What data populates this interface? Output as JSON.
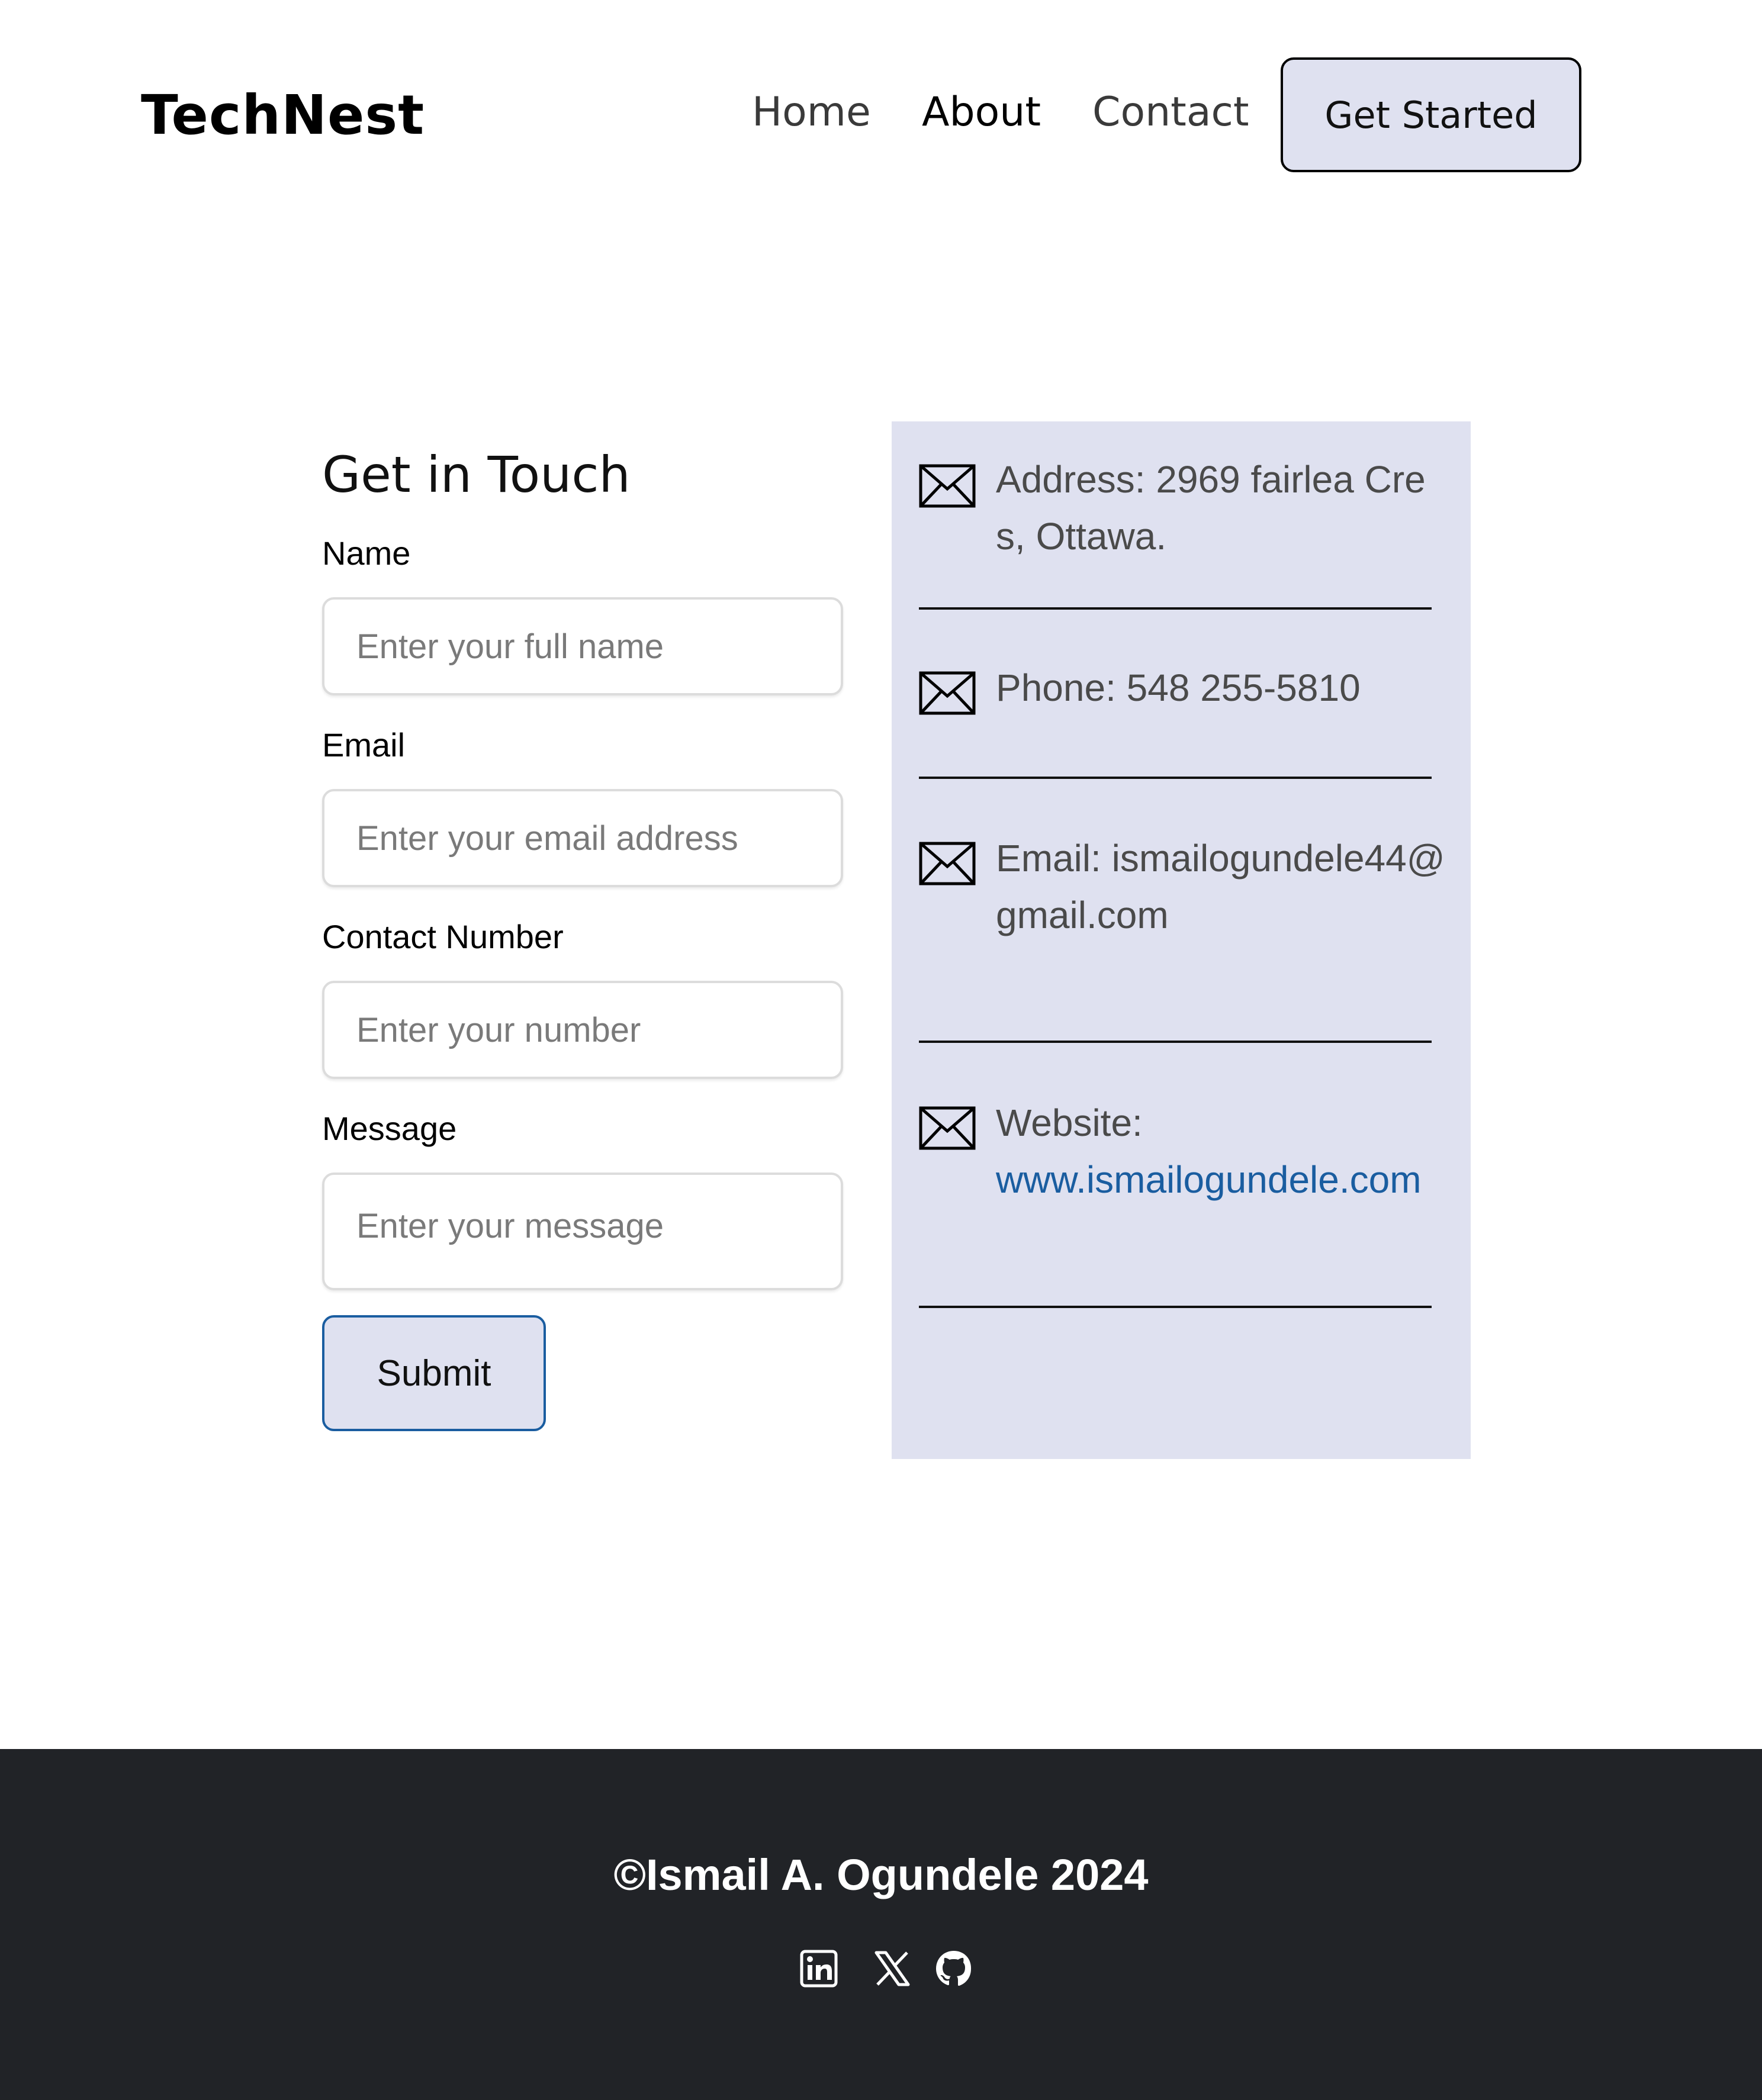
{
  "header": {
    "brand": "TechNest",
    "nav": {
      "home": "Home",
      "about": "About",
      "contact": "Contact"
    },
    "cta_label": "Get Started"
  },
  "form": {
    "title": "Get in Touch",
    "name_label": "Name",
    "name_placeholder": "Enter your full name",
    "email_label": "Email",
    "email_placeholder": "Enter your email address",
    "contact_label": "Contact Number",
    "contact_placeholder": "Enter your number",
    "message_label": "Message",
    "message_placeholder": "Enter your message",
    "submit_label": "Submit"
  },
  "info": {
    "address": "Address: 2969 fairlea Cres, Ottawa.",
    "phone": "Phone: 548 255-5810",
    "email": "Email: ismailogundele44@gmail.com",
    "website_label": "Website:",
    "website_url": "www.ismailogundele.com",
    "icon": "envelope-icon"
  },
  "footer": {
    "copyright": "©Ismail A. Ogundele 2024",
    "social": [
      "linkedin-icon",
      "x-icon",
      "github-icon"
    ]
  },
  "colors": {
    "panel_bg": "#dfe1f0",
    "link": "#1a5da0",
    "footer_bg": "#212327"
  }
}
